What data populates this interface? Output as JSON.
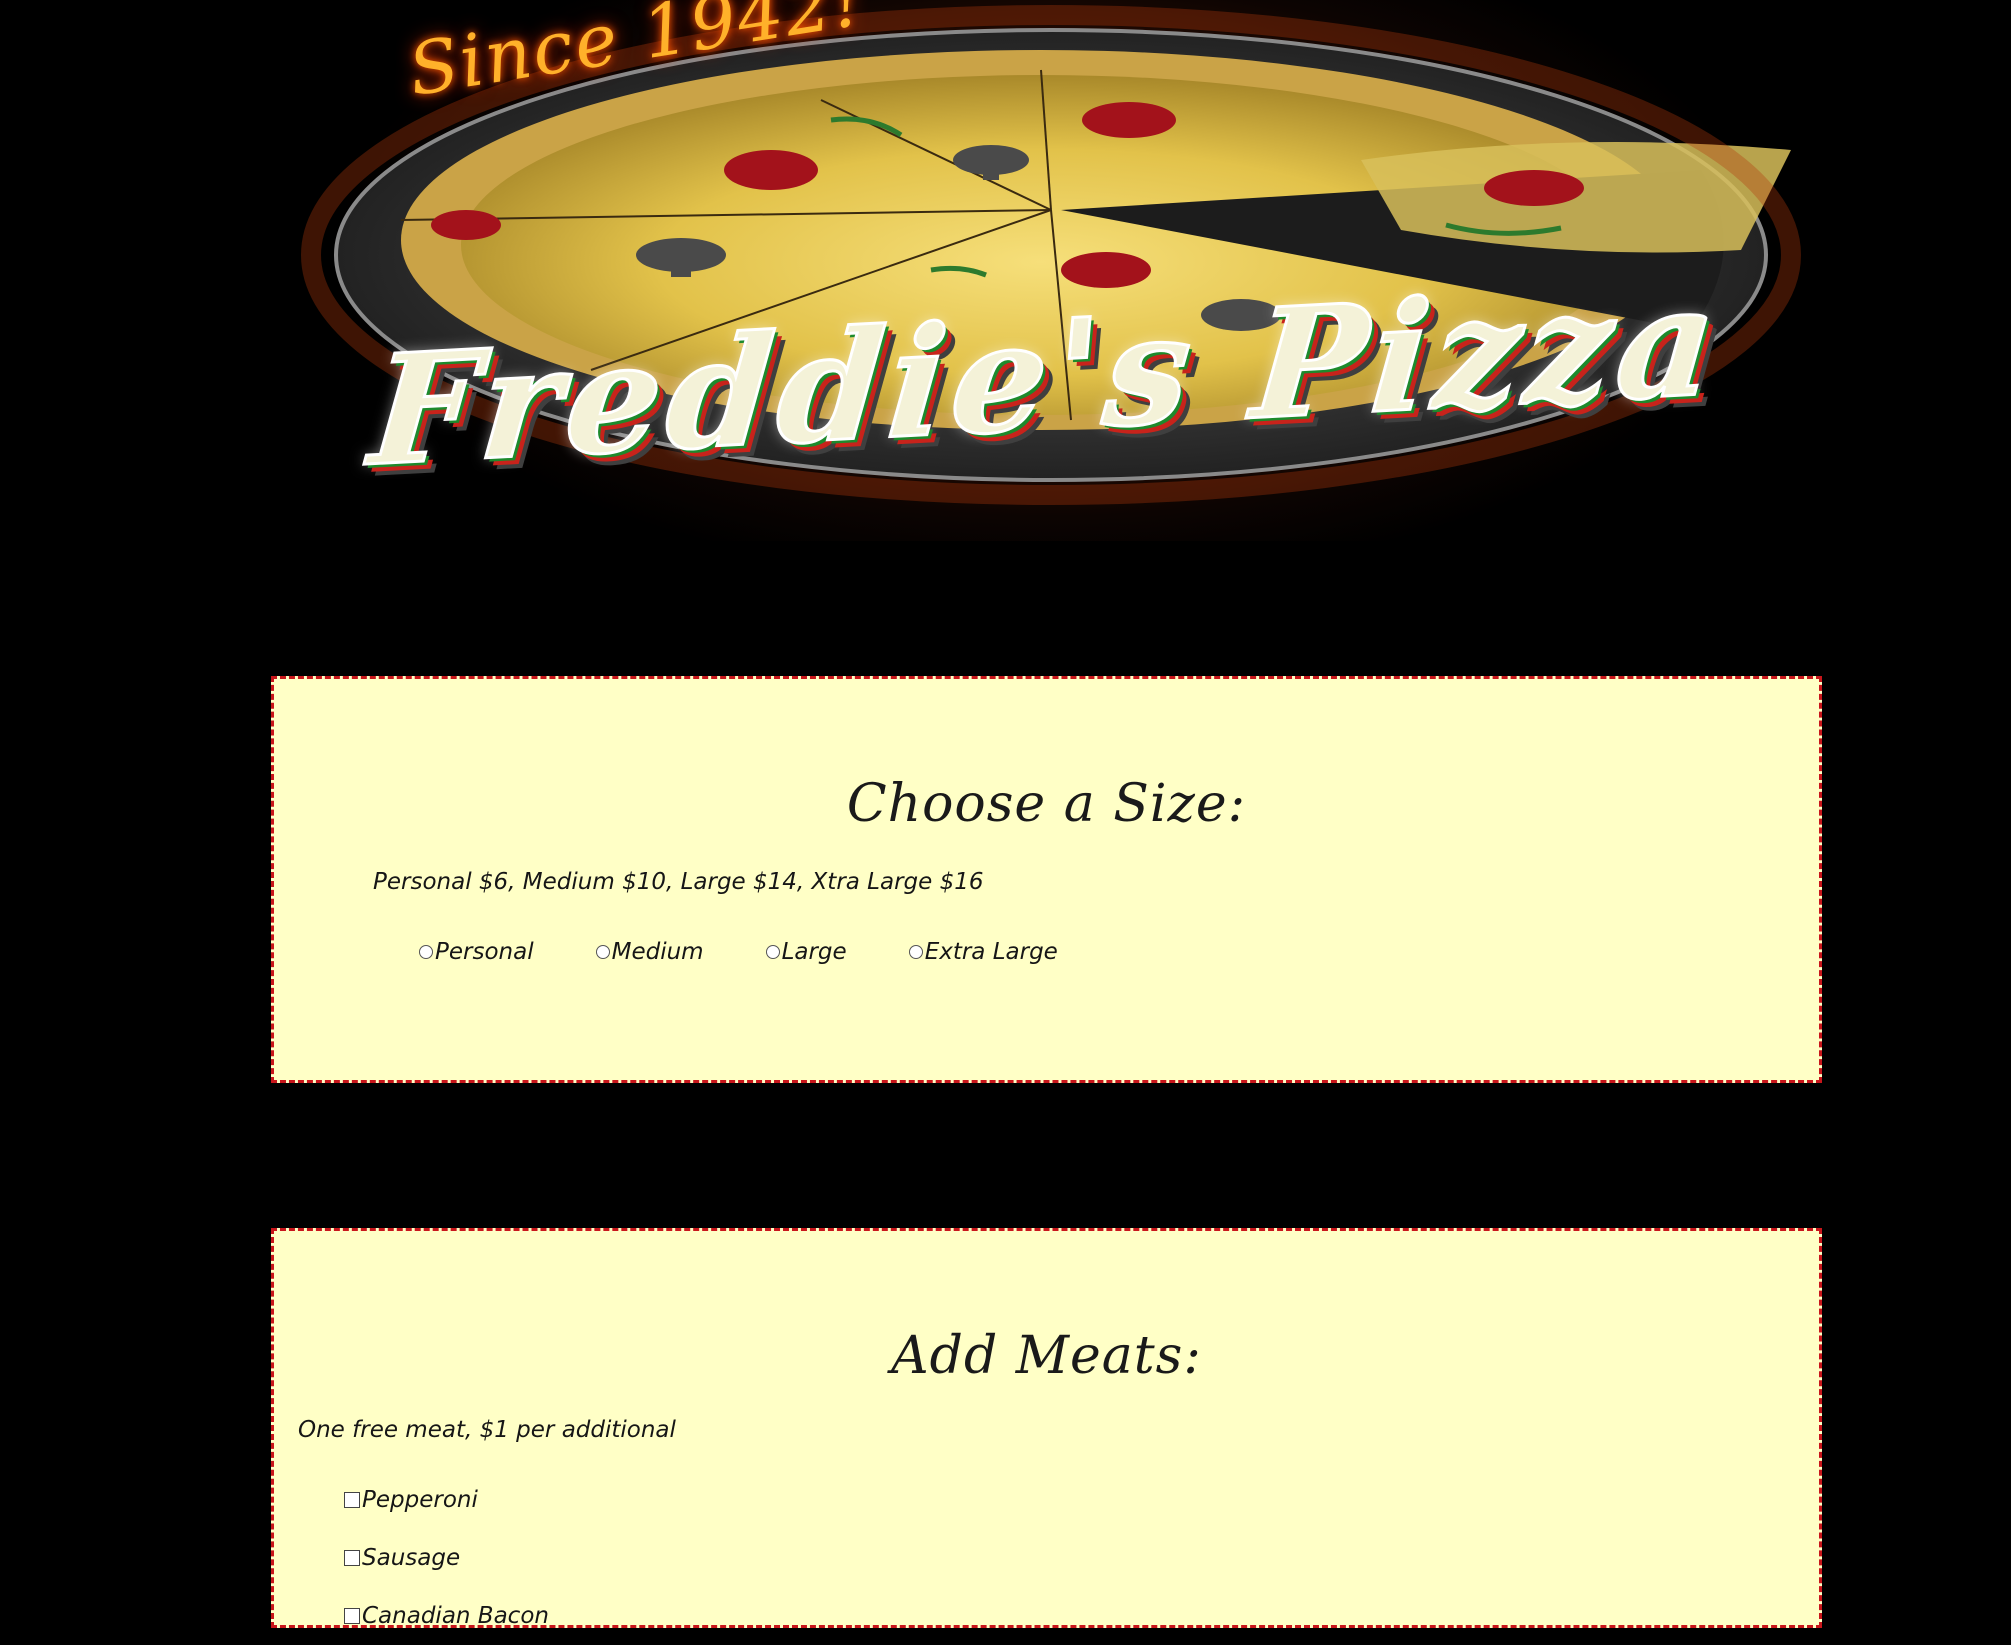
{
  "banner": {
    "since_text": "Since 1942!",
    "logo_text": "Freddie's Pizza"
  },
  "size_section": {
    "title": "Choose a Size:",
    "description": "Personal $6, Medium $10, Large $14, Xtra Large $16",
    "options": [
      "Personal",
      "Medium",
      "Large",
      "Extra Large"
    ]
  },
  "meats_section": {
    "title": "Add Meats:",
    "description": "One free meat, $1 per additional",
    "items": [
      "Pepperoni",
      "Sausage",
      "Canadian Bacon"
    ]
  },
  "colors": {
    "page_background": "#000000",
    "panel_background": "#ffffc6",
    "panel_border": "#c8161b"
  }
}
